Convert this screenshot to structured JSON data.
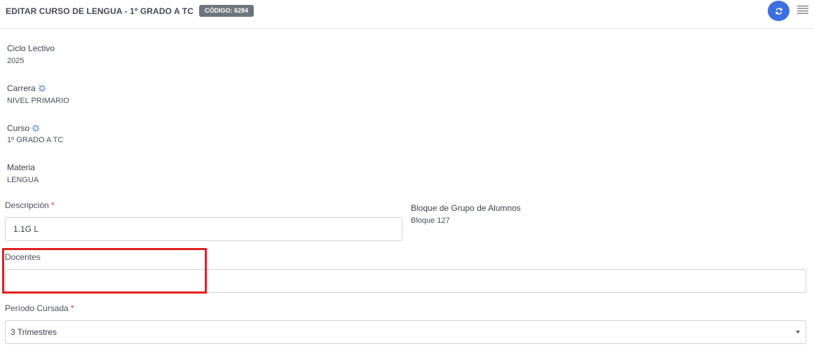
{
  "header": {
    "title": "EDITAR CURSO DE LENGUA - 1º GRADO A TC",
    "code_badge": "CÓDIGO: 6284",
    "refresh_icon": "refresh-icon",
    "menu_icon": "hamburger-menu-icon"
  },
  "fields": {
    "ciclo_lectivo": {
      "label": "Ciclo Lectivo",
      "value": "2025"
    },
    "carrera": {
      "label": "Carrera",
      "value": "NIVEL PRIMARIO",
      "icon": "gear-icon"
    },
    "curso": {
      "label": "Curso",
      "value": "1º GRADO A TC",
      "icon": "gear-icon"
    },
    "materia": {
      "label": "Materia",
      "value": "LENGUA"
    },
    "bloque": {
      "label": "Bloque de Grupo de Alumnos",
      "value": "Bloque 127"
    }
  },
  "form": {
    "descripcion": {
      "label": "Descripción",
      "required_mark": "*",
      "value": "1.1G L"
    },
    "docentes": {
      "label": "Docentes",
      "value": ""
    },
    "periodo": {
      "label": "Período Cursada",
      "required_mark": "*",
      "selected": "3 Trimestres"
    }
  },
  "colors": {
    "accent": "#3d6fe0",
    "badge": "#6c757d",
    "required": "#dc3545",
    "highlight": "#e02020"
  }
}
